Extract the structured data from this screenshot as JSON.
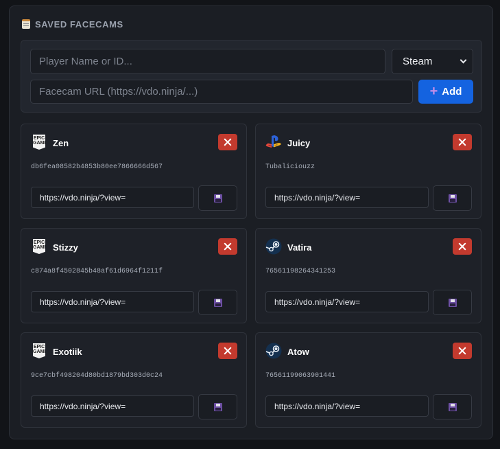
{
  "header": {
    "title": "SAVED FACECAMS",
    "icon": "clipboard-icon"
  },
  "form": {
    "player_placeholder": "Player Name or ID...",
    "platform_selected": "Steam",
    "url_placeholder": "Facecam URL (https://vdo.ninja/...)",
    "add_label": "Add"
  },
  "colors": {
    "accent": "#1463e0",
    "danger": "#c33a2e",
    "background": "#1b1e24"
  },
  "cards": [
    {
      "name": "Zen",
      "platform": "epic",
      "id": "db6fea08582b4853b80ee7866666d567",
      "url": "https://vdo.ninja/?view="
    },
    {
      "name": "Juicy",
      "platform": "playstation",
      "id": "Tubaliciouzz",
      "url": "https://vdo.ninja/?view="
    },
    {
      "name": "Stizzy",
      "platform": "epic",
      "id": "c874a8f4502845b48af61d6964f1211f",
      "url": "https://vdo.ninja/?view="
    },
    {
      "name": "Vatira",
      "platform": "steam",
      "id": "76561198264341253",
      "url": "https://vdo.ninja/?view="
    },
    {
      "name": "Exotiik",
      "platform": "epic",
      "id": "9ce7cbf498204d80bd1879bd303d0c24",
      "url": "https://vdo.ninja/?view="
    },
    {
      "name": "Atow",
      "platform": "steam",
      "id": "76561199063901441",
      "url": "https://vdo.ninja/?view="
    }
  ]
}
